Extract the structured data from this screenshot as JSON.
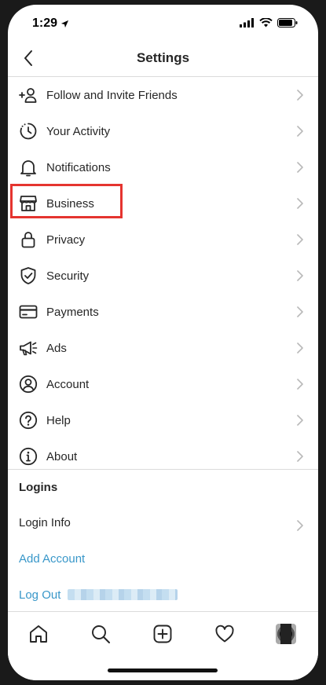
{
  "status_bar": {
    "time": "1:29"
  },
  "header": {
    "title": "Settings"
  },
  "menu": [
    {
      "label": "Follow and Invite Friends",
      "icon": "add-person-icon"
    },
    {
      "label": "Your Activity",
      "icon": "activity-clock-icon"
    },
    {
      "label": "Notifications",
      "icon": "bell-icon"
    },
    {
      "label": "Business",
      "icon": "storefront-icon"
    },
    {
      "label": "Privacy",
      "icon": "lock-icon"
    },
    {
      "label": "Security",
      "icon": "shield-icon"
    },
    {
      "label": "Payments",
      "icon": "credit-card-icon"
    },
    {
      "label": "Ads",
      "icon": "megaphone-icon"
    },
    {
      "label": "Account",
      "icon": "person-circle-icon"
    },
    {
      "label": "Help",
      "icon": "help-icon"
    },
    {
      "label": "About",
      "icon": "info-icon"
    }
  ],
  "logins": {
    "title": "Logins",
    "login_info": "Login Info",
    "add_account": "Add Account",
    "log_out": "Log Out"
  },
  "colors": {
    "accent_link": "#3897c9",
    "highlight_box": "#e5342f",
    "text_primary": "#262626",
    "divider": "#dbdbdb"
  }
}
